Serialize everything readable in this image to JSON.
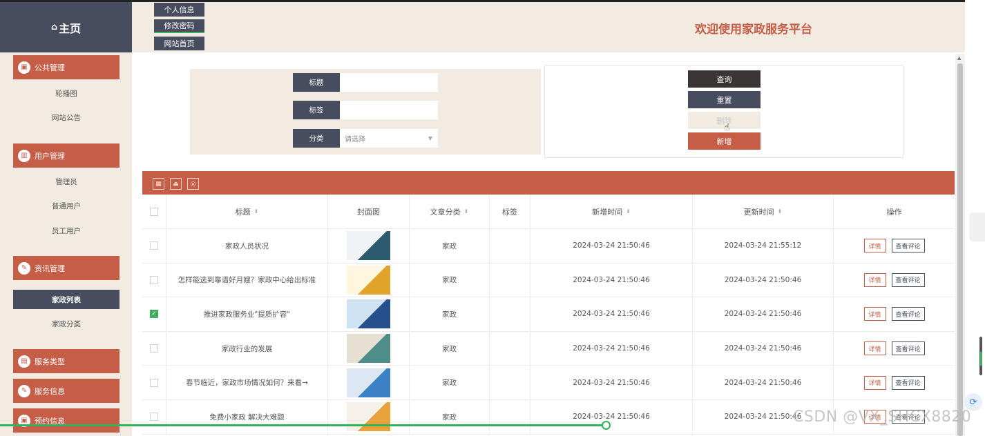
{
  "header": {
    "home_label": "主页",
    "home_icon": "home-icon",
    "top_buttons": [
      "个人信息",
      "修改密码",
      "网站首页"
    ],
    "welcome": "欢迎使用家政服务平台"
  },
  "sidebar": {
    "groups": [
      {
        "label": "公共管理",
        "icon": "bus-icon",
        "items": [
          "轮播图",
          "网站公告"
        ]
      },
      {
        "label": "用户管理",
        "icon": "bar-chart-icon",
        "items": [
          "管理员",
          "普通用户",
          "员工用户"
        ]
      },
      {
        "label": "资讯管理",
        "icon": "edit-icon",
        "items": [
          "家政列表",
          "家政分类"
        ]
      },
      {
        "label": "服务类型",
        "icon": "calendar-icon",
        "items": []
      },
      {
        "label": "服务信息",
        "icon": "edit-icon",
        "items": []
      },
      {
        "label": "预约信息",
        "icon": "bus-icon",
        "items": []
      }
    ],
    "selected_item": "家政列表"
  },
  "search": {
    "title_label": "标题",
    "title_value": "",
    "tag_label": "标签",
    "tag_value": "",
    "category_label": "分类",
    "category_placeholder": "请选择"
  },
  "actions": {
    "query": "查询",
    "reset": "重置",
    "delete": "删除",
    "add": "新增"
  },
  "toolbar_icons": [
    "export-icon",
    "import-icon",
    "print-icon"
  ],
  "table": {
    "columns": [
      "标题",
      "封面图",
      "文章分类",
      "标签",
      "新增时间",
      "更新时间",
      "操作"
    ],
    "rows": [
      {
        "title": "家政人员状况",
        "category": "家政",
        "tag": "",
        "created": "2024-03-24 21:50:46",
        "updated": "2024-03-24 21:55:12",
        "checked": false
      },
      {
        "title": "怎样能选到靠谱好月嫂？家政中心给出标准",
        "category": "家政",
        "tag": "",
        "created": "2024-03-24 21:50:46",
        "updated": "2024-03-24 21:50:46",
        "checked": false
      },
      {
        "title": "推进家政服务业\"提质扩容\"",
        "category": "家政",
        "tag": "",
        "created": "2024-03-24 21:50:46",
        "updated": "2024-03-24 21:50:46",
        "checked": true
      },
      {
        "title": "家政行业的发展",
        "category": "家政",
        "tag": "",
        "created": "2024-03-24 21:50:46",
        "updated": "2024-03-24 21:50:46",
        "checked": false
      },
      {
        "title": "春节临近，家政市场情况如何？来看→",
        "category": "家政",
        "tag": "",
        "created": "2024-03-24 21:50:46",
        "updated": "2024-03-24 21:50:46",
        "checked": false
      },
      {
        "title": "免费小家政 解决大难题",
        "category": "家政",
        "tag": "",
        "created": "2024-03-24 21:50:46",
        "updated": "2024-03-24 21:50:46",
        "checked": false
      }
    ],
    "detail_label": "详情",
    "review_label": "查看评论"
  },
  "video_progress": 0.616,
  "watermark": "CSDN @VX_SHCX8820",
  "colors": {
    "accent": "#c65d47",
    "dark": "#474d5e",
    "panel": "#f2ebe1",
    "green": "#3fae5e"
  }
}
